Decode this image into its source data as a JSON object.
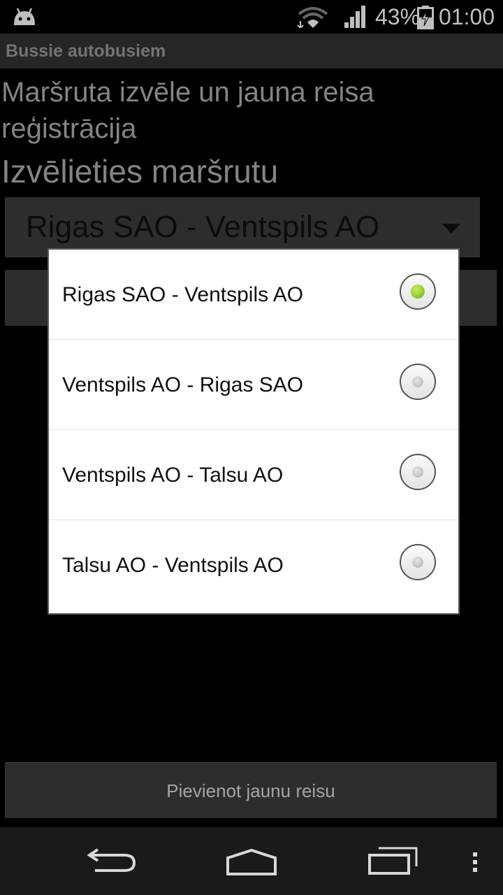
{
  "status_bar": {
    "battery_percent": "43%",
    "time": "01:00",
    "icons": [
      "android-icon",
      "wifi-icon",
      "signal-icon",
      "battery-charging-icon"
    ]
  },
  "app_bar": {
    "title": "Bussie autobusiem"
  },
  "page": {
    "heading": "Maršruta izvēle un jauna reisa reģistrācija",
    "subheading": "Izvēlieties maršrutu"
  },
  "route_spinner": {
    "selected_value": "Rigas SAO - Ventspils AO"
  },
  "route_dialog": {
    "options": [
      {
        "label": "Rigas SAO - Ventspils AO",
        "selected": true
      },
      {
        "label": "Ventspils AO - Rigas SAO",
        "selected": false
      },
      {
        "label": "Ventspils AO - Talsu AO",
        "selected": false
      },
      {
        "label": "Talsu AO - Ventspils AO",
        "selected": false
      }
    ]
  },
  "add_trip_button": {
    "label": "Pievienot jaunu reisu"
  },
  "nav_bar": {
    "icons": [
      "back-icon",
      "home-icon",
      "recents-icon",
      "overflow-menu-icon"
    ]
  },
  "colors": {
    "radio_selected": "#7ac21f",
    "background": "#000000",
    "dialog": "#ffffff"
  }
}
